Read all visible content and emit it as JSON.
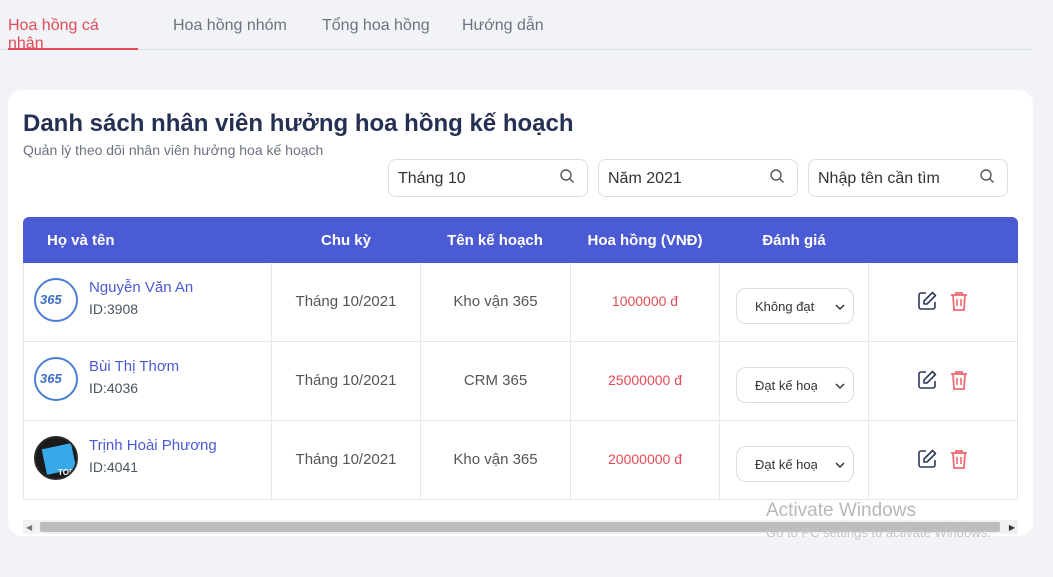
{
  "tabs": [
    {
      "label": "Hoa hồng cá nhân",
      "active": true
    },
    {
      "label": "Hoa hồng nhóm",
      "active": false
    },
    {
      "label": "Tổng hoa hồng",
      "active": false
    },
    {
      "label": "Hướng dẫn",
      "active": false
    }
  ],
  "card": {
    "title": "Danh sách nhân viên hưởng hoa hồng kế hoạch",
    "subtitle": "Quản lý theo dõi nhân viên hưởng hoa kế hoạch"
  },
  "filters": {
    "month": "Tháng 10",
    "year": "Năm 2021",
    "search_placeholder": "Nhập tên cần tìm"
  },
  "table": {
    "headers": {
      "name": "Họ và tên",
      "cycle": "Chu kỳ",
      "plan": "Tên kế hoạch",
      "commission": "Hoa hồng (VNĐ)",
      "rating": "Đánh giá"
    },
    "rows": [
      {
        "name": "Nguyễn Văn An",
        "id": "ID:3908",
        "cycle": "Tháng 10/2021",
        "plan": "Kho vận 365",
        "commission": "1000000 đ",
        "rating": "Không đạt",
        "avatar_logo": "365"
      },
      {
        "name": "Bùi Thị Thơm",
        "id": "ID:4036",
        "cycle": "Tháng 10/2021",
        "plan": "CRM 365",
        "commission": "25000000 đ",
        "rating": "Đạt kế hoạch",
        "avatar_logo": "365"
      },
      {
        "name": "Trịnh Hoài Phương",
        "id": "ID:4041",
        "cycle": "Tháng 10/2021",
        "plan": "Kho vận 365",
        "commission": "20000000 đ",
        "rating": "Đạt kế hoạch",
        "avatar_logo": "TOD"
      }
    ]
  },
  "watermark": {
    "title": "Activate Windows",
    "subtitle": "Go to PC settings to activate Windows."
  },
  "colors": {
    "accent": "#4b5bd4",
    "active_tab": "#e24b57",
    "money": "#e24b57",
    "delete": "#ef6b73"
  }
}
